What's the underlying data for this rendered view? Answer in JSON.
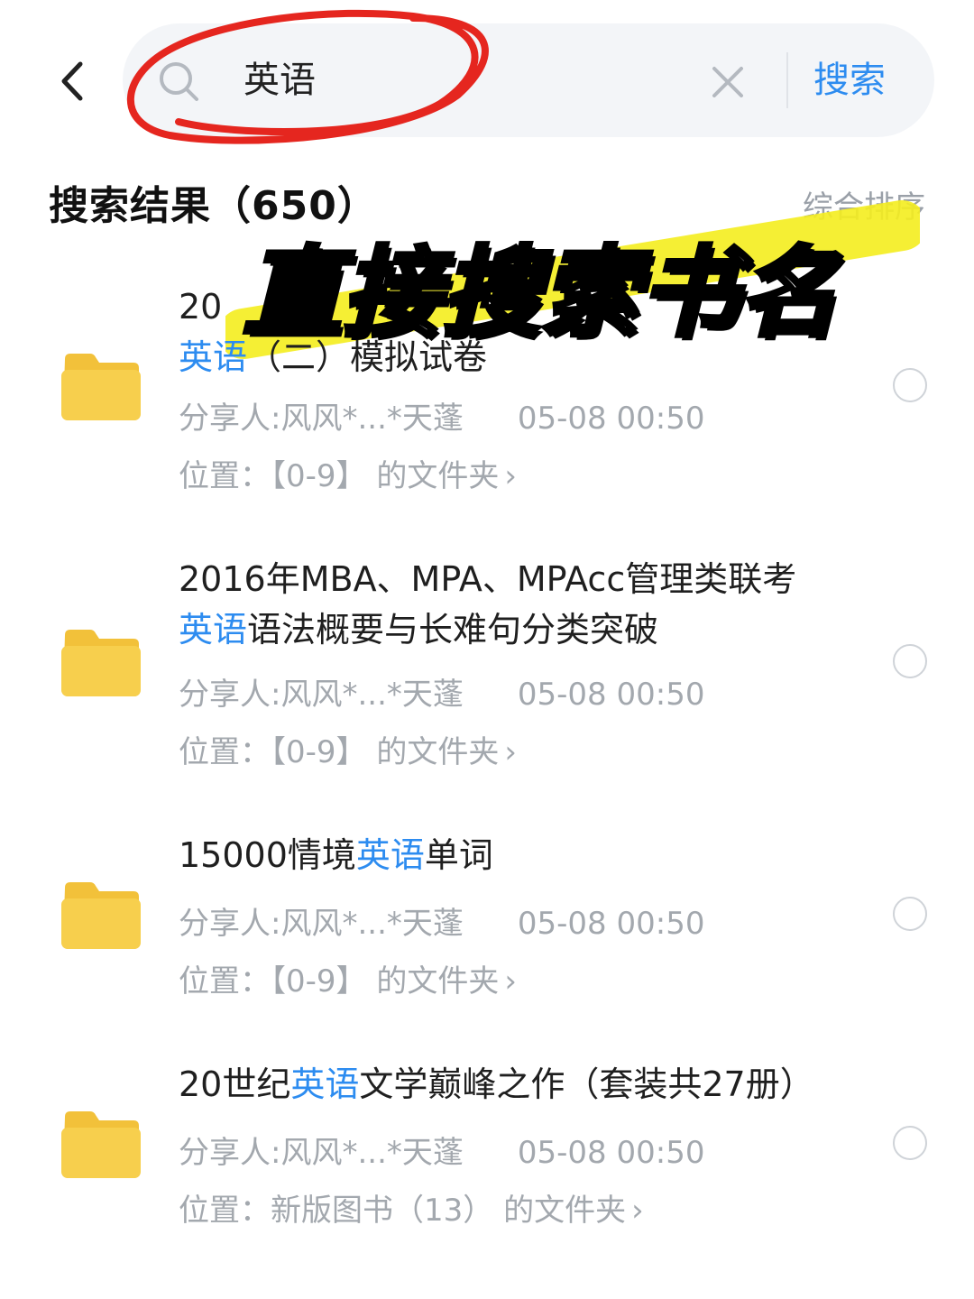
{
  "search": {
    "query": "英语",
    "button_label": "搜索"
  },
  "results_header": {
    "title": "搜索结果（650）",
    "sort_label": "综合排序"
  },
  "overlay_caption": "直接搜索书名",
  "results": [
    {
      "title_prefix": "20",
      "title_highlight": "英语",
      "title_suffix": "（二）模拟试卷",
      "sharer": "分享人:风风*...*天蓬",
      "date": "05-08 00:50",
      "location_prefix": "位置：",
      "location_folder": "【0-9】 的文件夹"
    },
    {
      "title_prefix": "2016年MBA、MPA、MPAcc管理类联考",
      "title_highlight": "英语",
      "title_suffix": "语法概要与长难句分类突破",
      "sharer": "分享人:风风*...*天蓬",
      "date": "05-08 00:50",
      "location_prefix": "位置：",
      "location_folder": "【0-9】 的文件夹"
    },
    {
      "title_prefix": "15000情境",
      "title_highlight": "英语",
      "title_suffix": "单词",
      "sharer": "分享人:风风*...*天蓬",
      "date": "05-08 00:50",
      "location_prefix": "位置：",
      "location_folder": "【0-9】 的文件夹"
    },
    {
      "title_prefix": "20世纪",
      "title_highlight": "英语",
      "title_suffix": "文学巅峰之作（套装共27册）",
      "sharer": "分享人:风风*...*天蓬",
      "date": "05-08 00:50",
      "location_prefix": "位置：",
      "location_folder": "新版图书（13） 的文件夹"
    }
  ],
  "icons": {
    "back": "chevron-left-icon",
    "search": "search-icon",
    "clear": "close-icon",
    "folder": "folder-icon",
    "radio": "radio-unchecked-icon"
  },
  "colors": {
    "accent": "#2d8cf0",
    "highlight_marker": "#f5ee1f",
    "annotation_circle": "#e5261f",
    "folder": "#f7cf4d"
  }
}
